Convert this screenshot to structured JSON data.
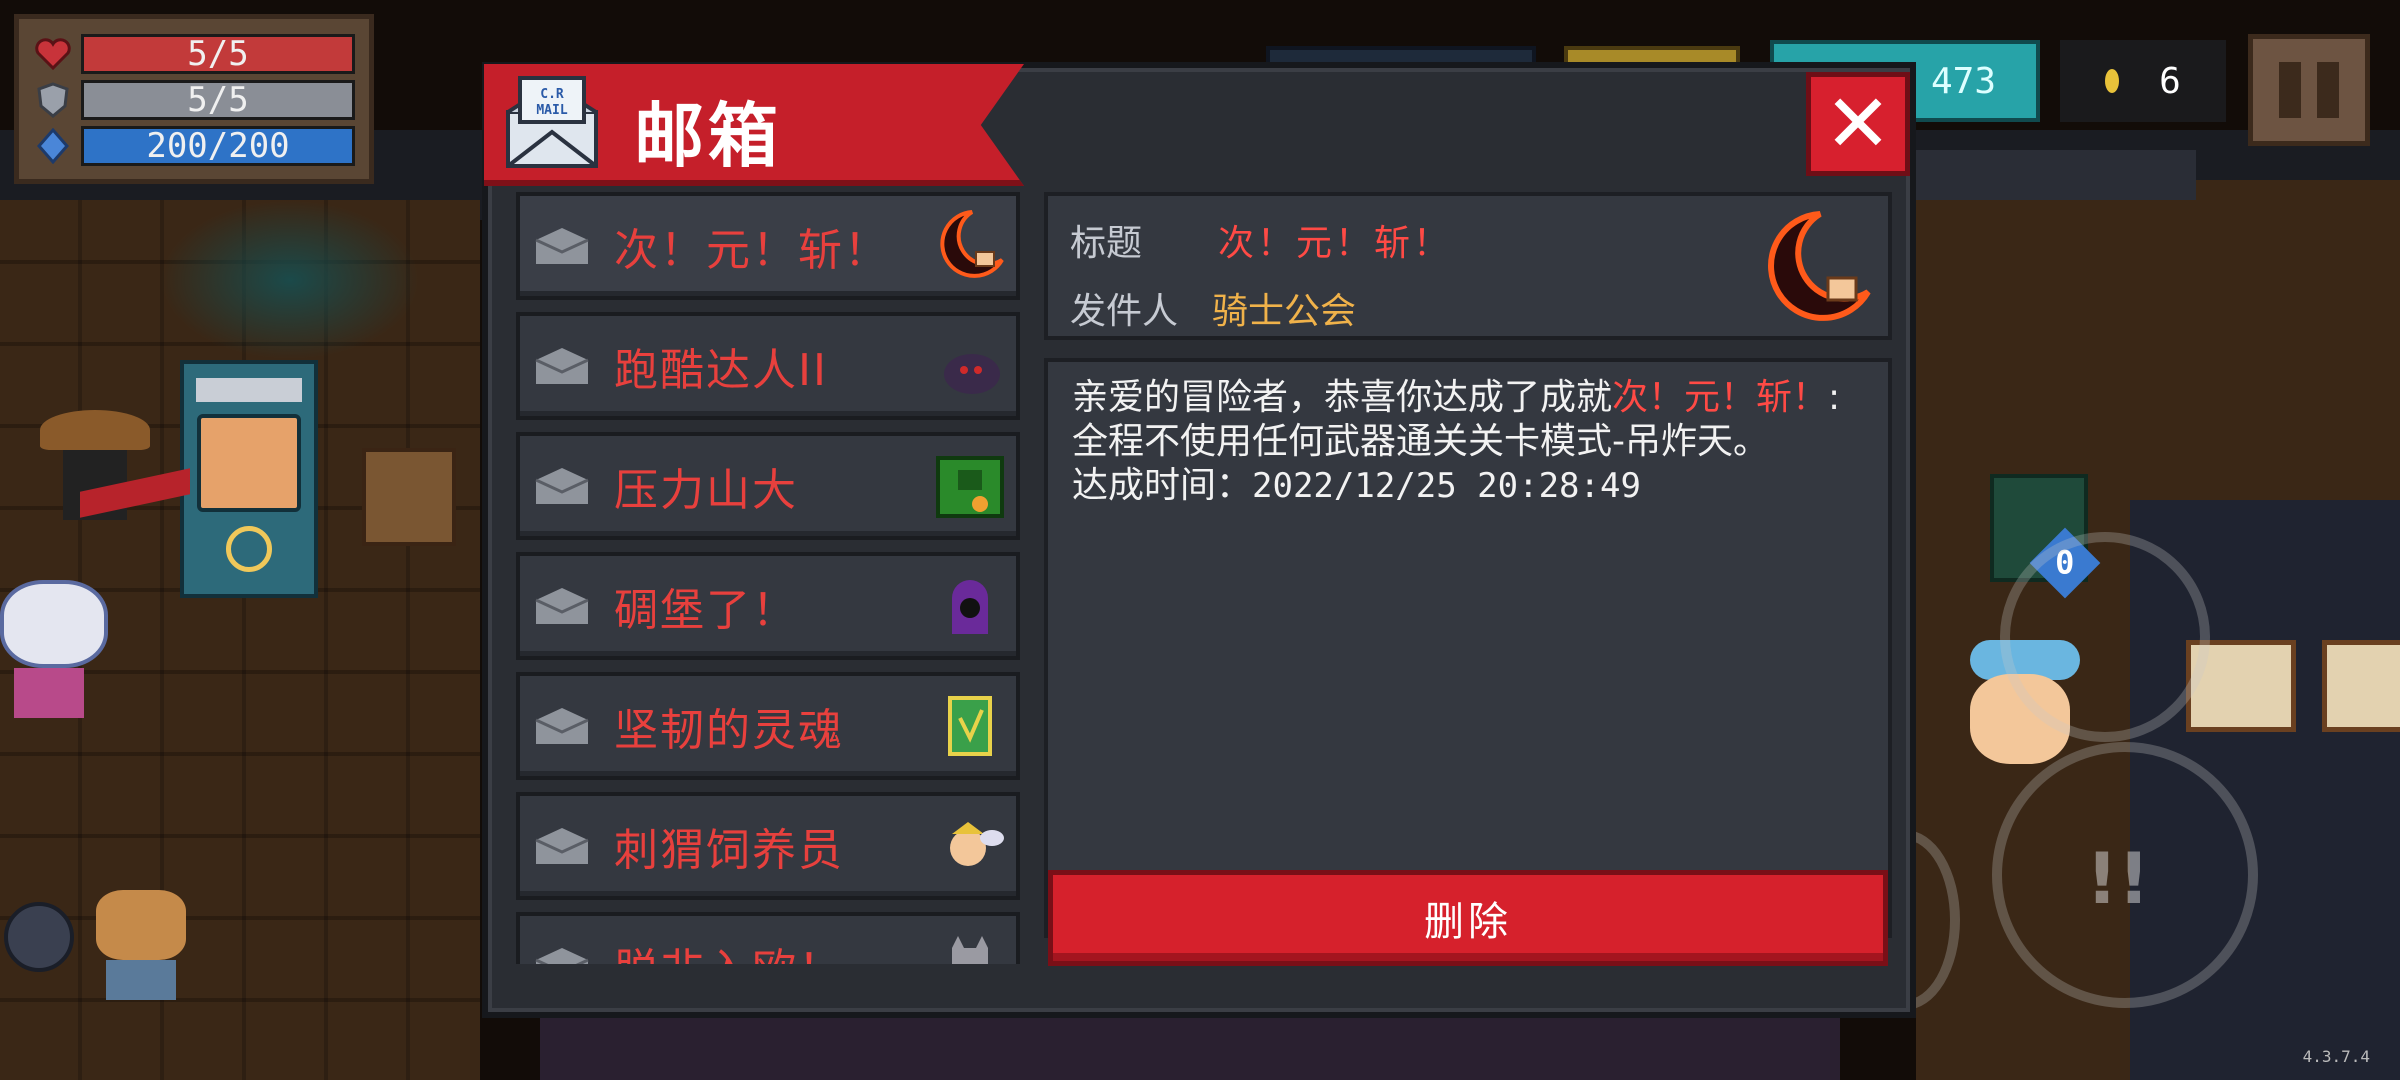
{
  "hud": {
    "health": "5/5",
    "armor": "5/5",
    "energy": "200/200",
    "gems": "473",
    "coins": "6",
    "version": "4.3.7.4",
    "floor_badge": "0"
  },
  "mailbox": {
    "title": "邮箱",
    "icon_text": "C.R MAIL",
    "close_label": "✕",
    "items": [
      {
        "title": "次！元！斩！",
        "thumb": "crescent-blade-icon"
      },
      {
        "title": "跑酷达人II",
        "thumb": "shadow-creature-icon"
      },
      {
        "title": "压力山大",
        "thumb": "green-boss-icon"
      },
      {
        "title": "碉堡了！",
        "thumb": "purple-ghost-icon"
      },
      {
        "title": "坚韧的灵魂",
        "thumb": "green-card-icon"
      },
      {
        "title": "刺猬饲养员",
        "thumb": "winged-pet-icon"
      },
      {
        "title": "脱非入欧！",
        "thumb": "grey-cat-icon"
      }
    ],
    "detail": {
      "subject_label": "标题",
      "subject": "次！元！斩！",
      "sender_label": "发件人",
      "sender": "骑士公会",
      "body_prefix": "亲爱的冒险者，恭喜你达成了成就",
      "body_highlight": "次！元！斩！",
      "body_suffix": ":全程不使用任何武器通关关卡模式-吊炸天。",
      "time_label": "达成时间：",
      "time_value": "2022/12/25 20:28:49",
      "delete_label": "删除"
    }
  },
  "colors": {
    "accent_red": "#d6212c",
    "highlight_red": "#ff4a45",
    "sender_gold": "#f0b24a",
    "panel": "#343840"
  }
}
